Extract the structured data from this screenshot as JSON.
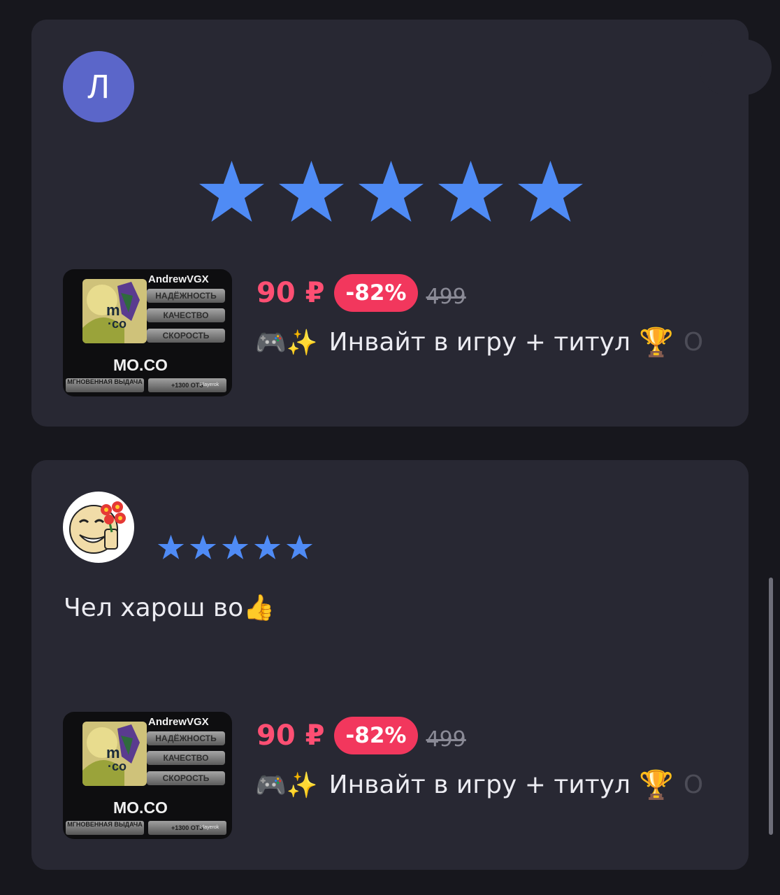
{
  "colors": {
    "background": "#17171d",
    "card": "#282833",
    "star": "#4f8bf5",
    "price": "#ff4f73",
    "discount_badge": "#f2375d",
    "avatar_letter_bg": "#5b66c9"
  },
  "reviews": [
    {
      "avatar": {
        "type": "letter",
        "letter": "Л"
      },
      "rating": 5,
      "text": "",
      "product": {
        "image": {
          "brand": "AndrewVGX",
          "tags": [
            "НАДЁЖНОСТЬ",
            "КАЧЕСТВО",
            "СКОРОСТЬ"
          ],
          "name": "MO.CO",
          "strip_left": "МГНОВЕННАЯ ВЫДАЧА",
          "strip_right": "+1300 ОТЗ",
          "watermark": "Playerok"
        },
        "price": "90 ₽",
        "discount": "-82%",
        "old_price": "499",
        "title_prefix": "🎮✨",
        "title": "Инвайт в игру + титул",
        "title_suffix": "🏆",
        "title_overflow": "О"
      }
    },
    {
      "avatar": {
        "type": "image",
        "icon": "smiley-with-flowers-icon"
      },
      "rating": 5,
      "text": "Чел харош во",
      "text_emoji": "👍",
      "product": {
        "image": {
          "brand": "AndrewVGX",
          "tags": [
            "НАДЁЖНОСТЬ",
            "КАЧЕСТВО",
            "СКОРОСТЬ"
          ],
          "name": "MO.CO",
          "strip_left": "МГНОВЕННАЯ ВЫДАЧА",
          "strip_right": "+1300 ОТЗ",
          "watermark": "Playerok"
        },
        "price": "90 ₽",
        "discount": "-82%",
        "old_price": "499",
        "title_prefix": "🎮✨",
        "title": "Инвайт в игру + титул",
        "title_suffix": "🏆",
        "title_overflow": "О"
      }
    }
  ]
}
